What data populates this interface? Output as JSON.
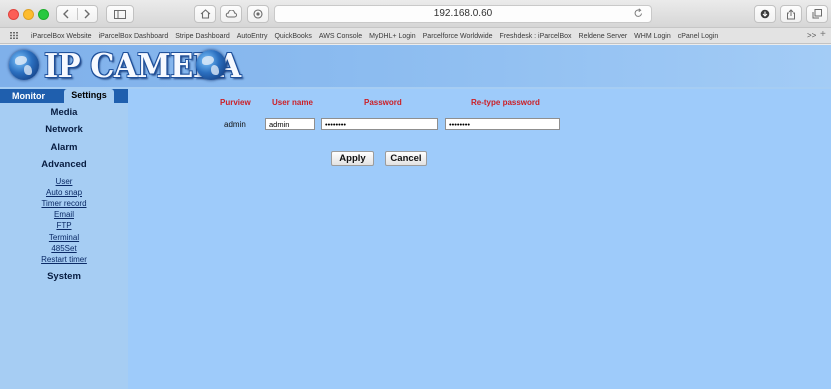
{
  "browser": {
    "address": "192.168.0.60",
    "bookmarks": [
      "iParcelBox Website",
      "iParcelBox Dashboard",
      "Stripe Dashboard",
      "AutoEntry",
      "QuickBooks",
      "AWS Console",
      "MyDHL+ Login",
      "Parcelforce Worldwide",
      "Freshdesk : iParcelBox",
      "Reldene Server",
      "WHM Login",
      "cPanel Login"
    ],
    "more_label": ">>",
    "add_label": "+"
  },
  "banner": {
    "logo_text": "IP CAMERA"
  },
  "nav": {
    "tab_monitor": "Monitor",
    "tab_settings": "Settings",
    "media": "Media",
    "network": "Network",
    "alarm": "Alarm",
    "advanced": "Advanced",
    "submenu": [
      "User",
      "Auto snap",
      "Timer record",
      "Email",
      "FTP",
      "Terminal",
      "485Set",
      "Restart timer"
    ],
    "system": "System"
  },
  "form": {
    "headers": {
      "purview": "Purview",
      "user_name": "User name",
      "password": "Password",
      "retype_password": "Re-type password"
    },
    "row": {
      "purview": "admin",
      "user_name": "admin",
      "password": "••••••••",
      "retype_password": "••••••••"
    },
    "apply_label": "Apply",
    "cancel_label": "Cancel"
  }
}
